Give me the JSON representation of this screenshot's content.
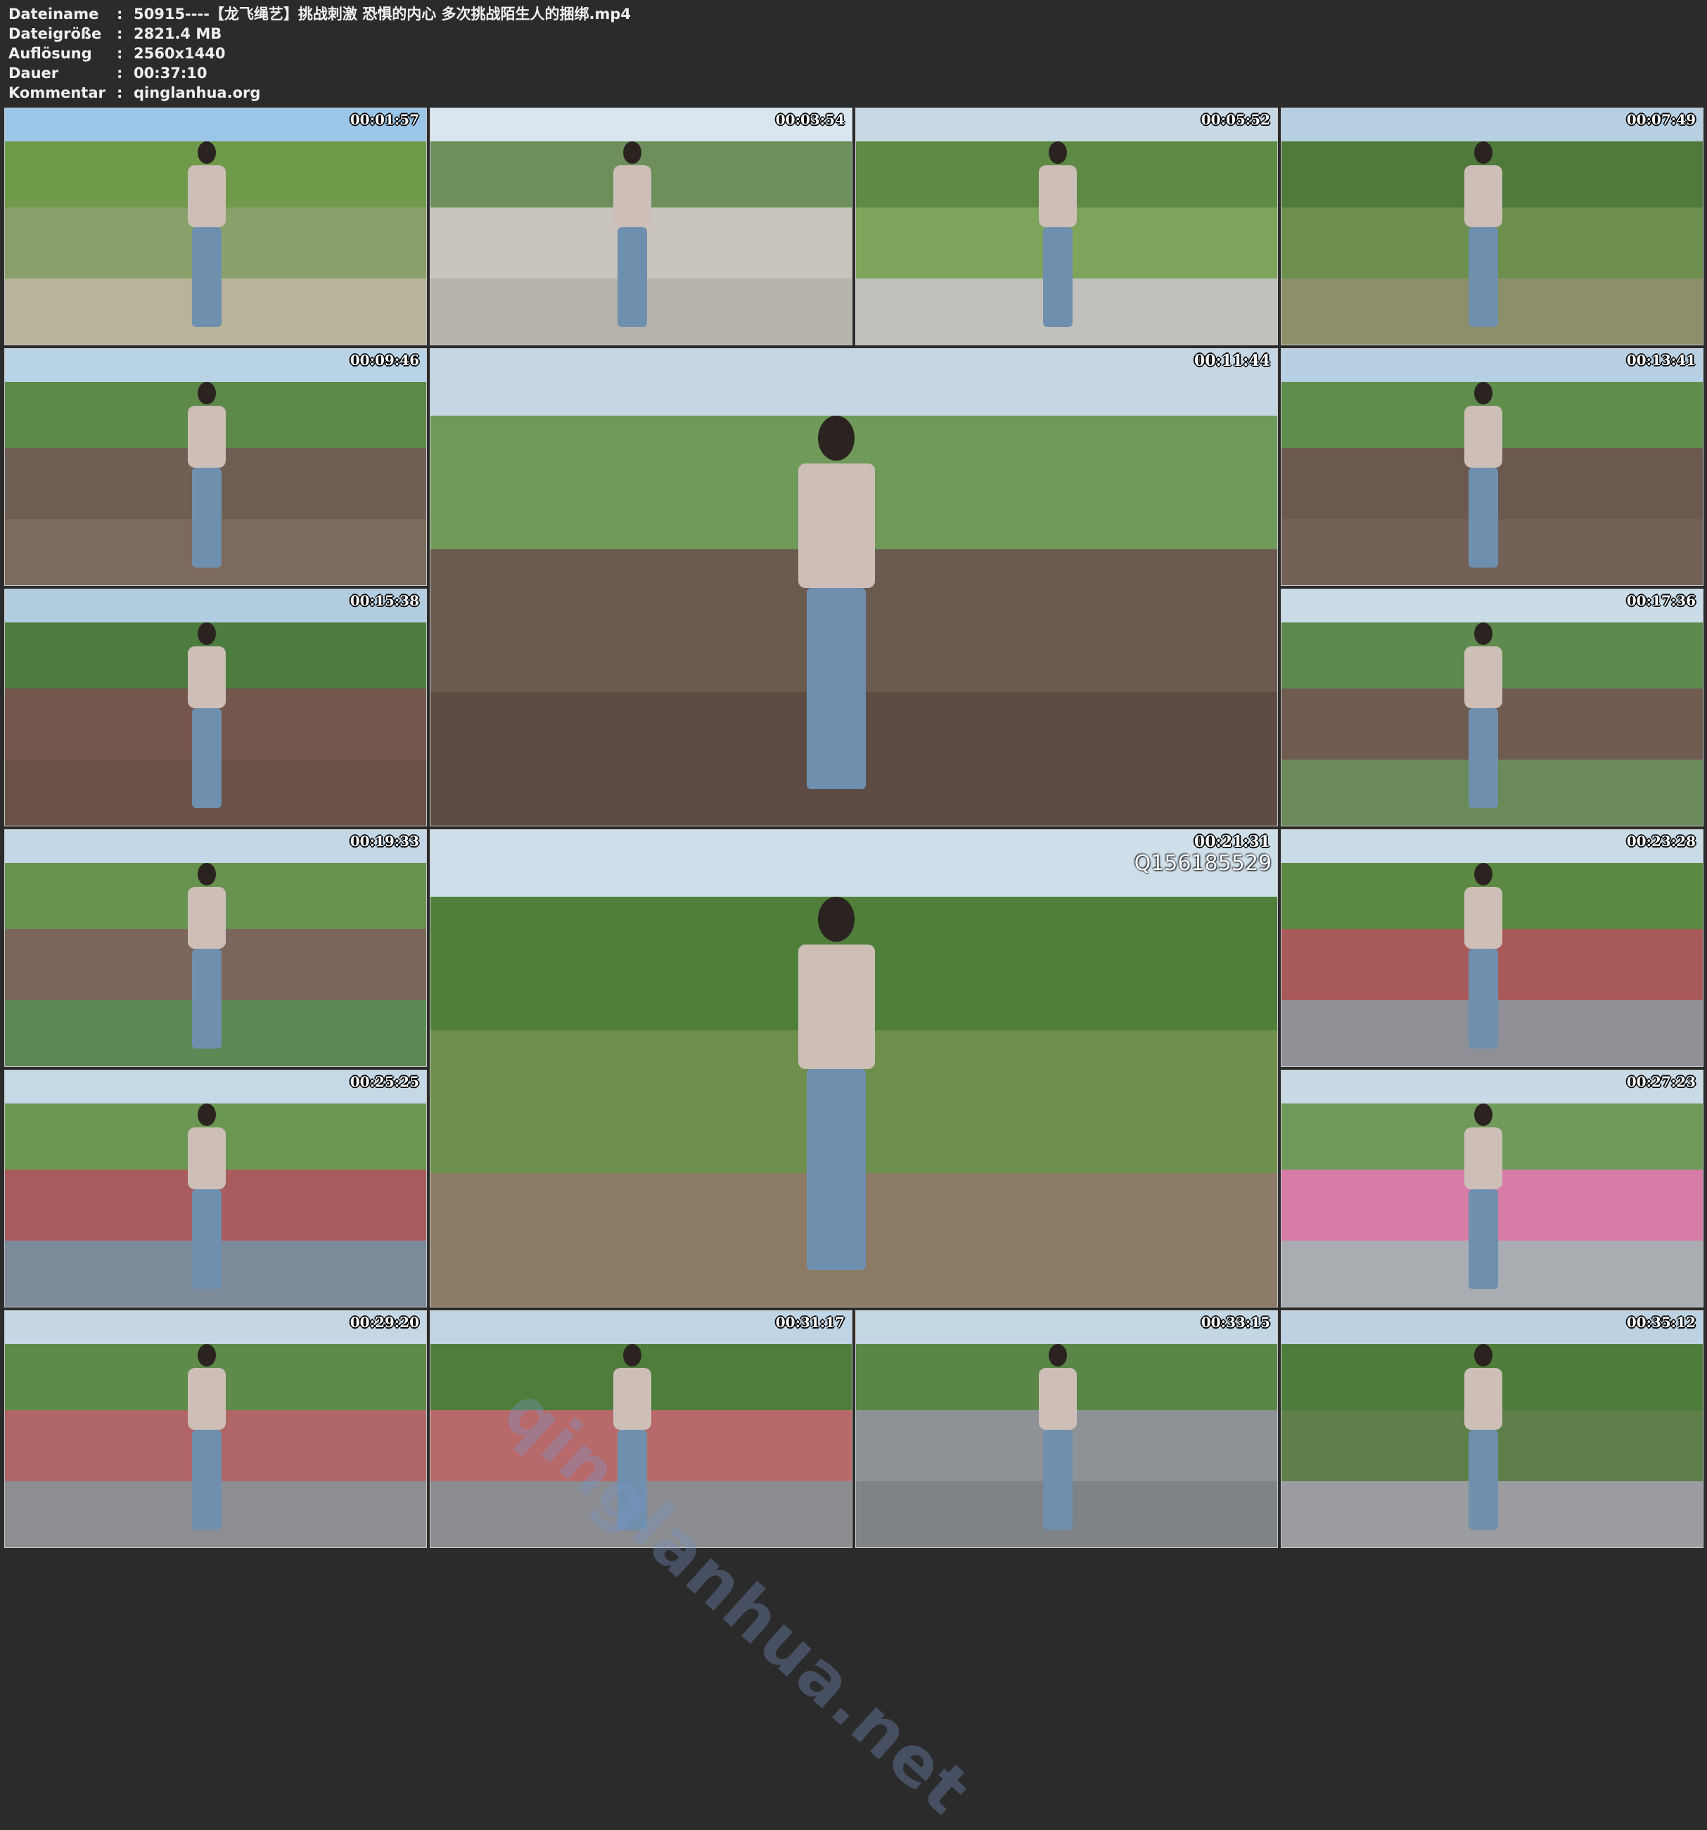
{
  "info": [
    {
      "key": "Dateiname",
      "value": "50915----【龙飞绳艺】挑战刺激 恐惧的内心 多次挑战陌生人的捆绑.mp4"
    },
    {
      "key": "Dateigröße",
      "value": "2821.4 MB"
    },
    {
      "key": "Auflösung",
      "value": "2560x1440"
    },
    {
      "key": "Dauer",
      "value": "00:37:10"
    },
    {
      "key": "Kommentar",
      "value": "qinglanhua.org"
    }
  ],
  "separator": ":",
  "thumbnails": [
    {
      "timestamp": "00:01:57",
      "scene": "park-grass"
    },
    {
      "timestamp": "00:03:54",
      "scene": "plaza-guards"
    },
    {
      "timestamp": "00:05:52",
      "scene": "park-path"
    },
    {
      "timestamp": "00:07:49",
      "scene": "trees-rope-fence"
    },
    {
      "timestamp": "00:09:46",
      "scene": "boardwalk"
    },
    {
      "timestamp": "00:11:44",
      "scene": "boardwalk-large"
    },
    {
      "timestamp": "00:13:41",
      "scene": "boardwalk-women"
    },
    {
      "timestamp": "00:15:38",
      "scene": "boardwalk-rail"
    },
    {
      "timestamp": "00:17:36",
      "scene": "boardwalk-lotus"
    },
    {
      "timestamp": "00:19:33",
      "scene": "boardwalk-lotus-2"
    },
    {
      "timestamp": "00:21:31",
      "scene": "fence-garden-large",
      "watermark": "Q156185529"
    },
    {
      "timestamp": "00:23:28",
      "scene": "red-path"
    },
    {
      "timestamp": "00:25:25",
      "scene": "flower-plaza"
    },
    {
      "timestamp": "00:27:23",
      "scene": "snack-cart"
    },
    {
      "timestamp": "00:29:20",
      "scene": "sidewalk-tiles"
    },
    {
      "timestamp": "00:31:17",
      "scene": "parking-lot"
    },
    {
      "timestamp": "00:33:15",
      "scene": "scooters"
    },
    {
      "timestamp": "00:35:12",
      "scene": "bicycle-tree"
    }
  ],
  "site_watermark": "qinglanhua.net"
}
